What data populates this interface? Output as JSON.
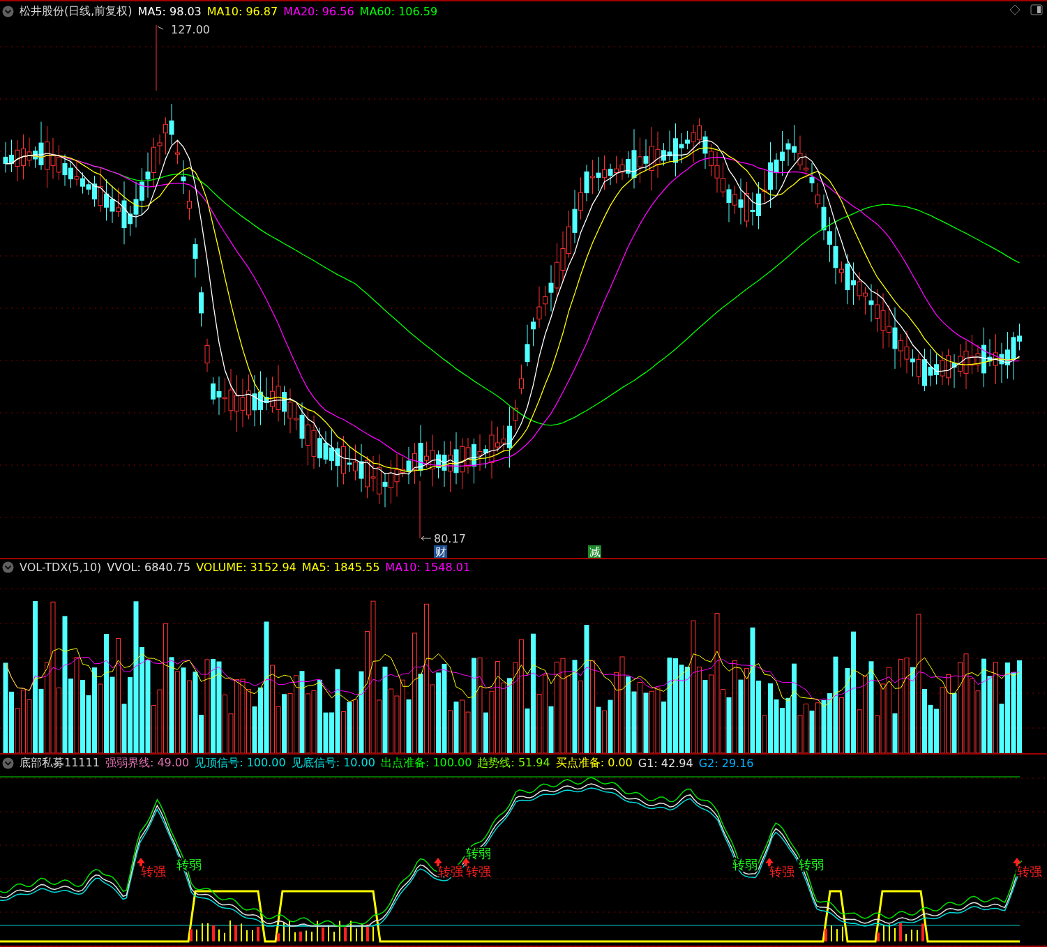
{
  "price_panel": {
    "title": "松井股份(日线,前复权)",
    "indicators": [
      {
        "label": "MA5: 98.03",
        "color": "#ffffff"
      },
      {
        "label": "MA10: 96.87",
        "color": "#ffff00"
      },
      {
        "label": "MA20: 96.56",
        "color": "#ff00ff"
      },
      {
        "label": "MA60: 106.59",
        "color": "#00ff00"
      }
    ],
    "high_marker": "127.00",
    "low_marker": "80.17",
    "event_tags": [
      {
        "label": "财",
        "color": "#1d4f8f"
      },
      {
        "label": "减",
        "color": "#1e8a2c"
      }
    ]
  },
  "volume_panel": {
    "title": "VOL-TDX(5,10)",
    "indicators": [
      {
        "label": "VVOL: 6840.75",
        "color": "#e0e0e0"
      },
      {
        "label": "VOLUME: 3152.94",
        "color": "#ffff00"
      },
      {
        "label": "MA5: 1845.55",
        "color": "#ffff00"
      },
      {
        "label": "MA10: 1548.01",
        "color": "#ff00ff"
      }
    ]
  },
  "indicator_panel": {
    "title": "底部私募11111",
    "indicators": [
      {
        "label": "强弱界线: 49.00",
        "color": "#e070b0"
      },
      {
        "label": "见顶信号: 100.00",
        "color": "#00e0e0"
      },
      {
        "label": "见底信号: 10.00",
        "color": "#00e0e0"
      },
      {
        "label": "出点准备: 100.00",
        "color": "#00ff00"
      },
      {
        "label": "趋势线: 51.94",
        "color": "#7cff00"
      },
      {
        "label": "买点准备: 0.00",
        "color": "#ffff00"
      },
      {
        "label": "G1: 42.94",
        "color": "#e0e0e0"
      },
      {
        "label": "G2: 29.16",
        "color": "#00b0ff"
      }
    ],
    "signals": [
      {
        "label": "转强",
        "kind": "strong"
      },
      {
        "label": "转弱",
        "kind": "weak"
      },
      {
        "label": "转强",
        "kind": "strong"
      },
      {
        "label": "转弱",
        "kind": "weak"
      },
      {
        "label": "转强",
        "kind": "strong"
      },
      {
        "label": "转弱",
        "kind": "weak"
      },
      {
        "label": "转强",
        "kind": "strong"
      },
      {
        "label": "转弱",
        "kind": "weak"
      },
      {
        "label": "转强",
        "kind": "strong"
      }
    ]
  }
}
